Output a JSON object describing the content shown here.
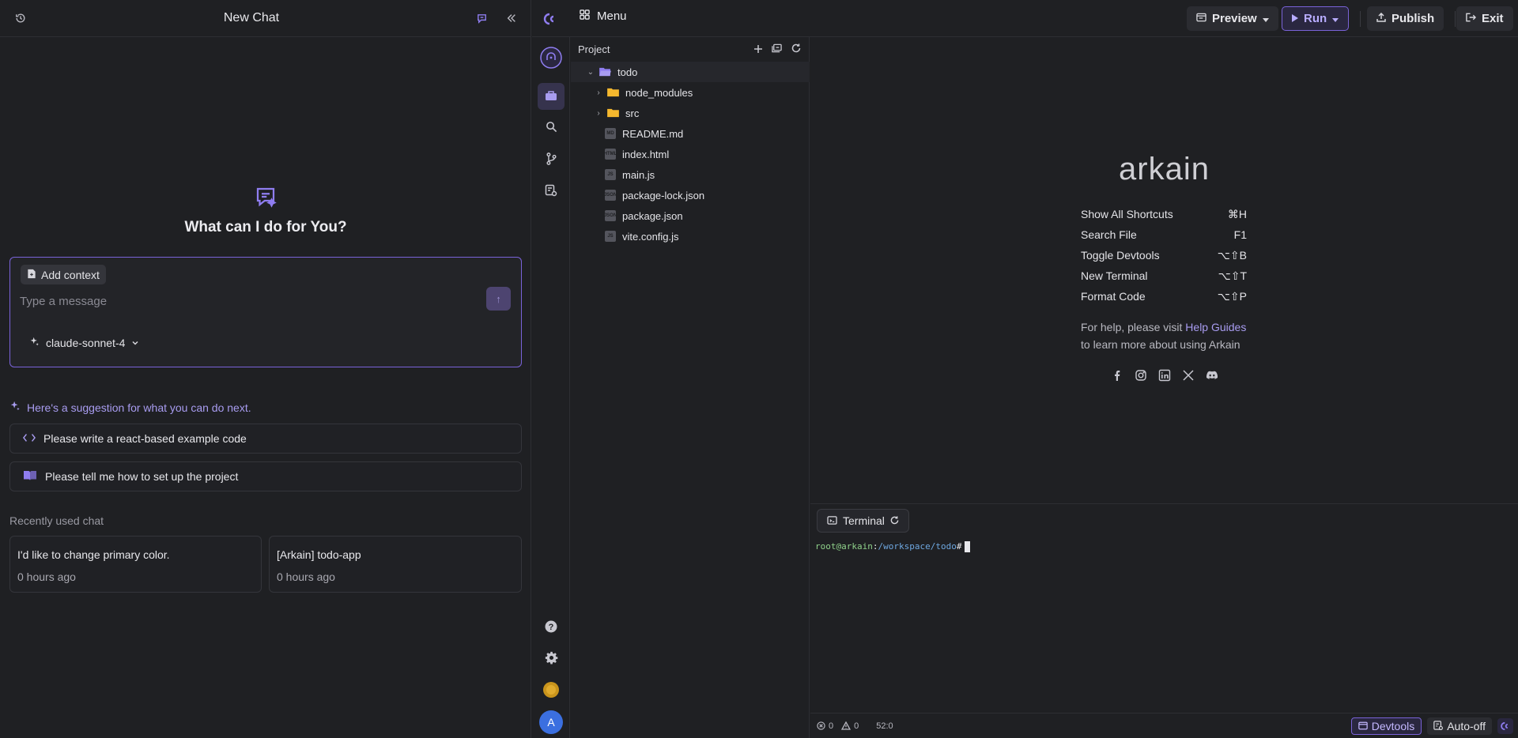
{
  "chat": {
    "header_title": "New Chat",
    "hero_title": "What can I do for You?",
    "add_context_label": "Add context",
    "message_placeholder": "Type a message",
    "model_label": "claude-sonnet-4",
    "suggestion_heading": "Here's a suggestion for what you can do next.",
    "suggestions": [
      "Please write a react-based example code",
      "Please tell me how to set up the project"
    ],
    "recent_heading": "Recently used chat",
    "recent": [
      {
        "title": "I'd like to change primary color.",
        "time": "0 hours ago"
      },
      {
        "title": "[Arkain] todo-app",
        "time": "0 hours ago"
      }
    ]
  },
  "topbar": {
    "menu_label": "Menu",
    "preview_label": "Preview",
    "run_label": "Run",
    "publish_label": "Publish",
    "exit_label": "Exit"
  },
  "activity": {
    "avatar_letter": "A"
  },
  "explorer": {
    "heading": "Project",
    "root": "todo",
    "folders": [
      "node_modules",
      "src"
    ],
    "files": [
      {
        "name": "README.md",
        "type": "MD"
      },
      {
        "name": "index.html",
        "type": "HTML"
      },
      {
        "name": "main.js",
        "type": "JS"
      },
      {
        "name": "package-lock.json",
        "type": "JSON"
      },
      {
        "name": "package.json",
        "type": "JSON"
      },
      {
        "name": "vite.config.js",
        "type": "JS"
      }
    ]
  },
  "welcome": {
    "logo": "arkain",
    "shortcuts": [
      {
        "label": "Show All Shortcuts",
        "keys": "⌘H"
      },
      {
        "label": "Search File",
        "keys": "F1"
      },
      {
        "label": "Toggle Devtools",
        "keys": "⌥⇧B"
      },
      {
        "label": "New Terminal",
        "keys": "⌥⇧T"
      },
      {
        "label": "Format Code",
        "keys": "⌥⇧P"
      }
    ],
    "help_prefix": "For help, please visit ",
    "help_link": "Help Guides",
    "help_suffix": "to learn more about using Arkain"
  },
  "terminal": {
    "tab_label": "Terminal",
    "prompt_user": "root@arkain",
    "prompt_sep": ":",
    "prompt_path": "/workspace/todo",
    "prompt_end": "#"
  },
  "statusbar": {
    "errors": "0",
    "warnings": "0",
    "position": "52:0",
    "devtools_label": "Devtools",
    "autooff_label": "Auto-off"
  },
  "colors": {
    "accent": "#7a63d9",
    "accent_text": "#a89cf0",
    "background": "#1f2023",
    "folder": "#f5b82e"
  }
}
